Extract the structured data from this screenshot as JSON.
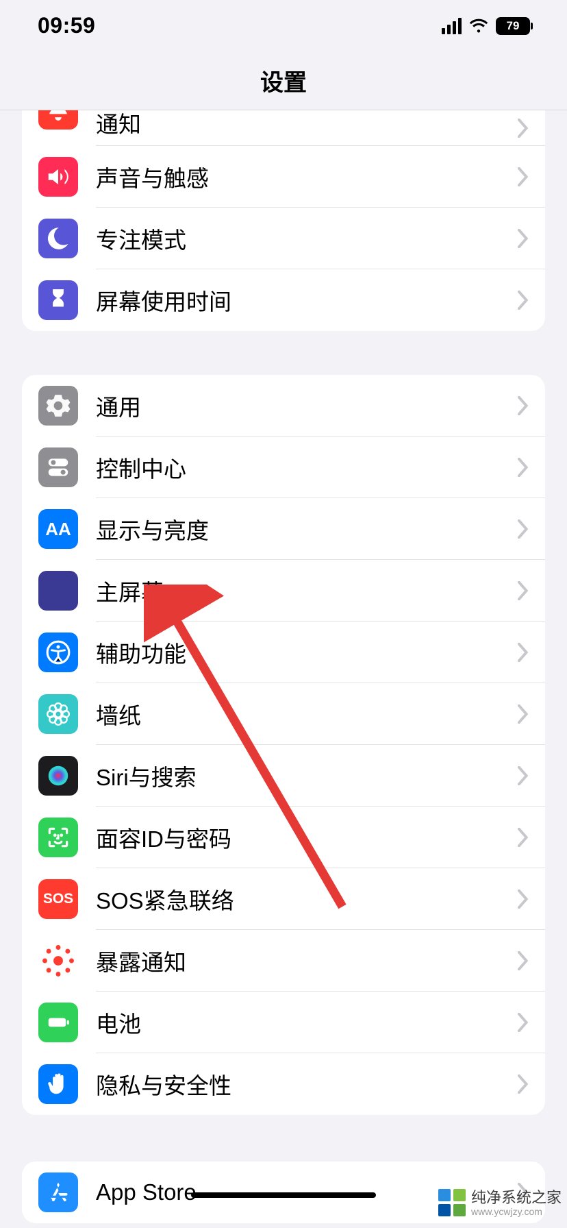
{
  "status": {
    "time": "09:59",
    "battery": "79"
  },
  "header": {
    "title": "设置"
  },
  "groups": {
    "g0": [
      {
        "label": "通知"
      },
      {
        "label": "声音与触感"
      },
      {
        "label": "专注模式"
      },
      {
        "label": "屏幕使用时间"
      }
    ],
    "g1": [
      {
        "label": "通用"
      },
      {
        "label": "控制中心"
      },
      {
        "label": "显示与亮度"
      },
      {
        "label": "主屏幕"
      },
      {
        "label": "辅助功能"
      },
      {
        "label": "墙纸"
      },
      {
        "label": "Siri与搜索"
      },
      {
        "label": "面容ID与密码"
      },
      {
        "label": "SOS紧急联络"
      },
      {
        "label": "暴露通知"
      },
      {
        "label": "电池"
      },
      {
        "label": "隐私与安全性"
      }
    ],
    "g2": [
      {
        "label": "App Store"
      }
    ]
  },
  "watermark": {
    "name": "纯净系统之家",
    "url": "www.ycwjzy.com"
  }
}
